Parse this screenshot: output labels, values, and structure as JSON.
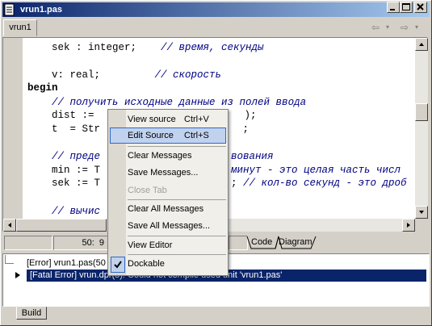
{
  "window": {
    "title": "vrun1.pas"
  },
  "tabs": [
    {
      "label": "vrun1"
    }
  ],
  "code": [
    {
      "text": "    sek : integer;    ",
      "comment": "// время, секунды"
    },
    {
      "text": "",
      "comment": ""
    },
    {
      "text": "    v: real;         ",
      "comment": "// скорость"
    },
    {
      "text": "begin",
      "comment": "",
      "bold": true
    },
    {
      "text": "    ",
      "comment": "// получить исходные данные из полей ввода"
    },
    {
      "text": "    dist :=",
      "tail": "   );"
    },
    {
      "text": "    t  = Str",
      "tail": "   ;"
    },
    {
      "text": "",
      "comment": ""
    },
    {
      "text": "    ",
      "comment": "// преде",
      "tail_comment": "вования"
    },
    {
      "text": "    min := T",
      "tail_comment": "минут - это целая часть числ"
    },
    {
      "text": "    sek := T",
      "tail": "; ",
      "tail_comment": "// кол-во секунд - это дроб"
    },
    {
      "text": "",
      "comment": ""
    },
    {
      "text": "    ",
      "comment": "// вычис"
    }
  ],
  "status": {
    "position": "50:  9"
  },
  "sheet_tabs": [
    "Code",
    "Diagram"
  ],
  "messages": [
    {
      "text": "[Error] vrun1.pas(50"
    },
    {
      "text": "[Fatal Error] vrun.dpr(5): Could not compile used unit 'vrun1.pas'"
    }
  ],
  "bottom_tab": "Build",
  "context_menu": {
    "items": [
      {
        "label": "View source",
        "shortcut": "Ctrl+V"
      },
      {
        "label": "Edit Source",
        "shortcut": "Ctrl+S"
      },
      {
        "label": "Clear Messages",
        "shortcut": ""
      },
      {
        "label": "Save Messages...",
        "shortcut": ""
      },
      {
        "label": "Close Tab",
        "shortcut": ""
      },
      {
        "label": "Clear All Messages",
        "shortcut": ""
      },
      {
        "label": "Save All Messages...",
        "shortcut": ""
      },
      {
        "label": "View Editor",
        "shortcut": ""
      },
      {
        "label": "Dockable",
        "shortcut": "",
        "checked": true
      }
    ]
  },
  "icons": {
    "title": "document-icon",
    "minimize": "minimize-icon",
    "maximize": "maximize-icon",
    "close": "close-icon",
    "back": "arrow-left-icon",
    "forward": "arrow-right-icon",
    "check": "check-icon",
    "row_marker": "triangle-right-icon"
  }
}
